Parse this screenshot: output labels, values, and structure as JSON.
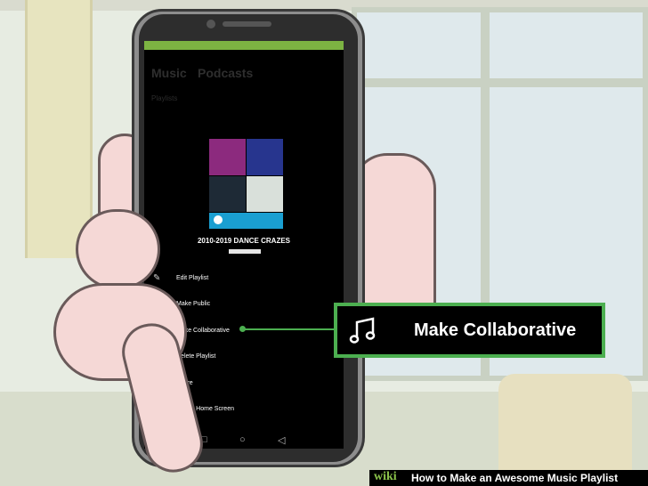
{
  "screen": {
    "tabs": [
      {
        "label": "Music"
      },
      {
        "label": "Podcasts"
      }
    ],
    "section_label": "Playlists",
    "playlist_title": "2010-2019 DANCE CRAZES",
    "menu": [
      {
        "label": "Edit Playlist",
        "icon": "pencil-icon"
      },
      {
        "label": "Make Public",
        "icon": "globe-icon"
      },
      {
        "label": "Make Collaborative",
        "icon": "music-note-icon"
      },
      {
        "label": "Delete Playlist",
        "icon": "close-icon"
      },
      {
        "label": "Share",
        "icon": "share-icon"
      },
      {
        "label": "Add to Home Screen",
        "icon": "home-icon"
      }
    ],
    "nav": [
      {
        "icon": "square-icon"
      },
      {
        "icon": "circle-icon"
      },
      {
        "icon": "triangle-icon"
      }
    ],
    "accent_color": "#7cb342"
  },
  "callout": {
    "label": "Make Collaborative",
    "icon": "music-note-icon",
    "border_color": "#4caf50"
  },
  "footer": {
    "brand": "wiki",
    "title": "How to Make an Awesome Music Playlist"
  }
}
